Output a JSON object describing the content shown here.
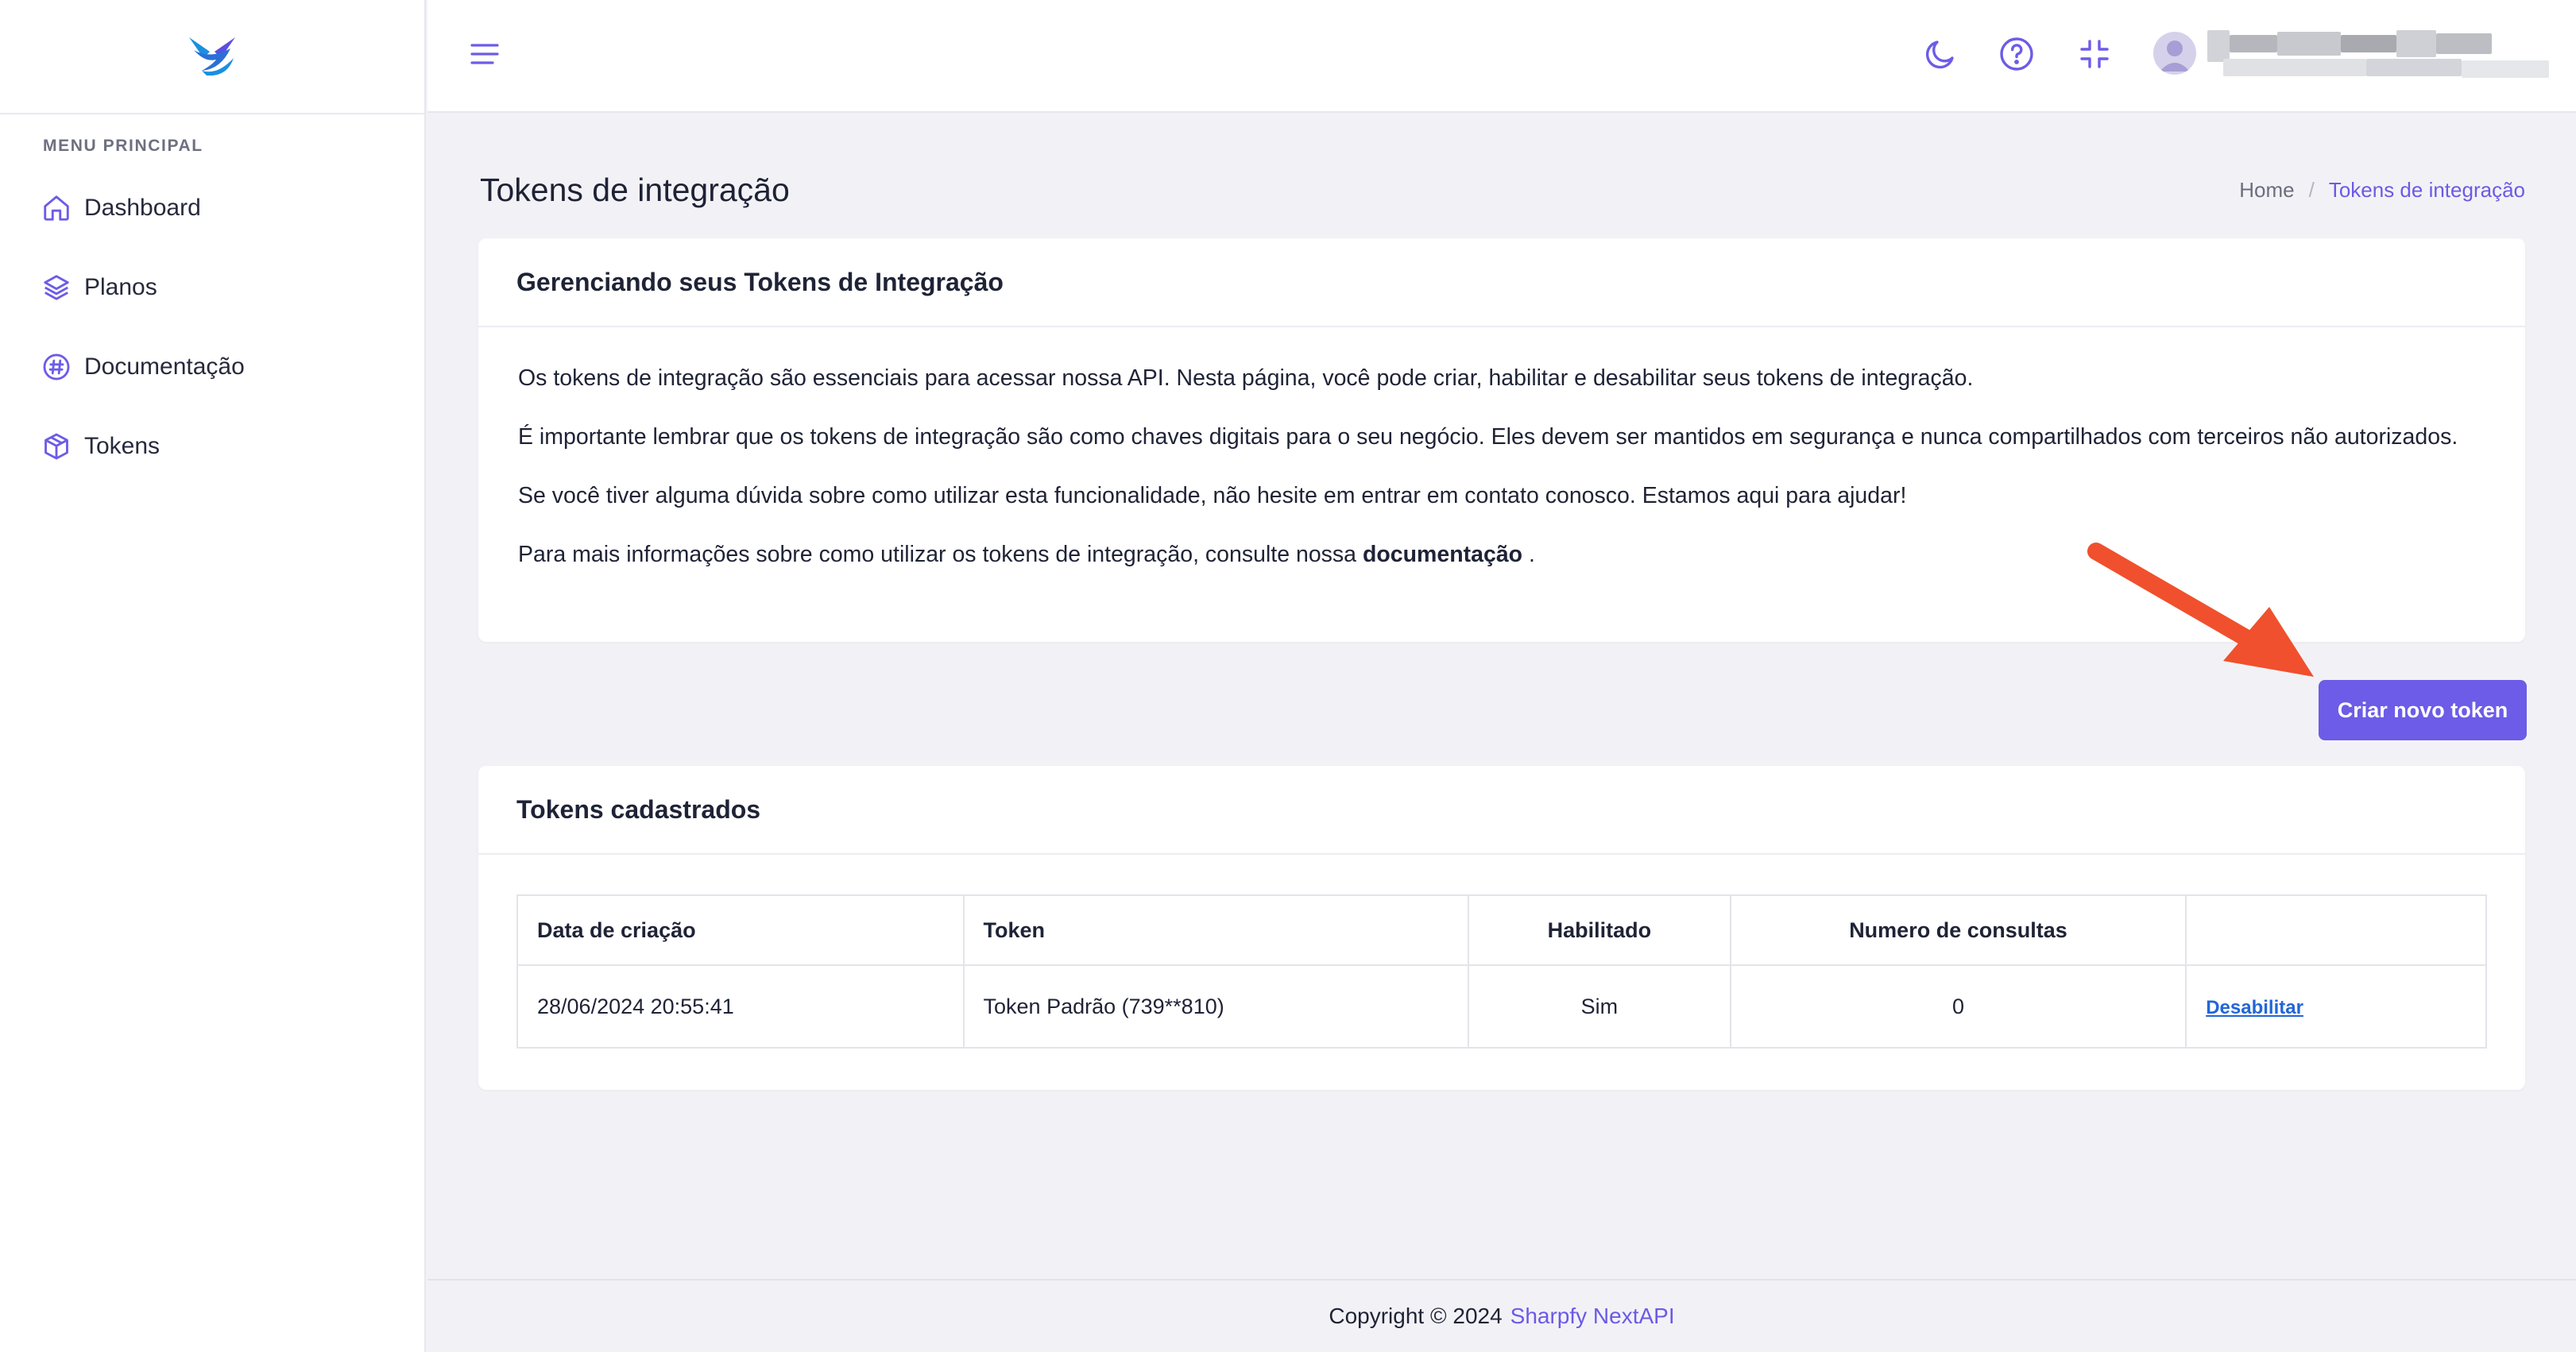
{
  "sidebar": {
    "menu_heading": "MENU PRINCIPAL",
    "items": [
      {
        "label": "Dashboard",
        "icon": "home-icon"
      },
      {
        "label": "Planos",
        "icon": "layers-icon"
      },
      {
        "label": "Documentação",
        "icon": "hash-icon"
      },
      {
        "label": "Tokens",
        "icon": "box-icon"
      }
    ]
  },
  "topbar": {
    "icons": [
      "menu-icon",
      "moon-icon",
      "help-icon",
      "minimize-icon",
      "user-avatar-icon"
    ]
  },
  "page": {
    "title": "Tokens de integração",
    "breadcrumb": {
      "home": "Home",
      "separator": "/",
      "current": "Tokens de integração"
    }
  },
  "info_card": {
    "title": "Gerenciando seus Tokens de Integração",
    "p1": "Os tokens de integração são essenciais para acessar nossa API. Nesta página, você pode criar, habilitar e desabilitar seus tokens de integração.",
    "p2": "É importante lembrar que os tokens de integração são como chaves digitais para o seu negócio. Eles devem ser mantidos em segurança e nunca compartilhados com terceiros não autorizados.",
    "p3": "Se você tiver alguma dúvida sobre como utilizar esta funcionalidade, não hesite em entrar em contato conosco. Estamos aqui para ajudar!",
    "p4_prefix": "Para mais informações sobre como utilizar os tokens de integração, consulte nossa ",
    "p4_link": "documentação",
    "p4_suffix": " ."
  },
  "create_button": {
    "label": "Criar novo token"
  },
  "tokens_card": {
    "title": "Tokens cadastrados",
    "columns": [
      "Data de criação",
      "Token",
      "Habilitado",
      "Numero de consultas",
      ""
    ],
    "rows": [
      {
        "created": "28/06/2024 20:55:41",
        "token": "Token Padrão (739**810)",
        "enabled": "Sim",
        "queries": "0",
        "action": "Desabilitar"
      }
    ]
  },
  "footer": {
    "text": "Copyright © 2024",
    "brand": "Sharpfy NextAPI"
  },
  "colors": {
    "accent": "#6c5ce7",
    "annotation_arrow": "#f0502d",
    "link": "#2266d6"
  }
}
